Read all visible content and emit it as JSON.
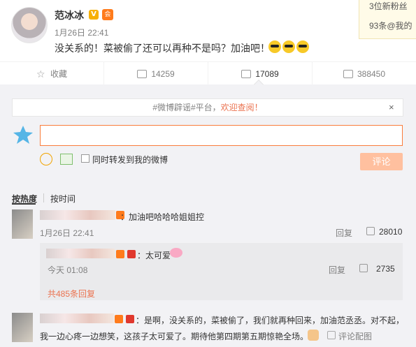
{
  "post": {
    "username": "范冰冰",
    "v_badge": "V",
    "vip_badge": "会",
    "time": "1月26日 22:41",
    "text": "没关系的！菜被偷了还可以再种不是吗？加油吧！"
  },
  "side_panel": {
    "line1": "3位新粉丝",
    "line2": "93条@我的"
  },
  "actions": {
    "favorite_label": "收藏",
    "repost_count": "14259",
    "comment_count": "17089",
    "like_count": "388450"
  },
  "notice": {
    "prefix": "#微博辟谣#平台，",
    "highlight": "欢迎查阅！",
    "close": "×"
  },
  "compose": {
    "placeholder": "",
    "repost_label": "同时转发到我的微博",
    "submit_label": "评论"
  },
  "sort_tabs": {
    "hot": "按热度",
    "time": "按时间"
  },
  "comments": [
    {
      "text": "：加油吧哈哈哈姐姐控",
      "time": "1月26日 22:41",
      "reply_label": "回复",
      "likes": "28010"
    },
    {
      "text": "：太可爱",
      "time": "今天 01:08",
      "reply_label": "回复",
      "likes": "2735",
      "more_replies": "共485条回复"
    },
    {
      "text_line1": "：是啊，没关系的，菜被偷了，我们就再种回来，加油范丞丞。对不起，",
      "text_line2": "我一边心疼一边想笑，这孩子太可爱了。期待他第四期第五期惊艳全场。",
      "report_label": "评论配图"
    }
  ],
  "colors": {
    "accent": "#eb7350",
    "compose_border": "#fa7d3c",
    "submit_disabled": "#ffc09f",
    "area_bg": "#f2f2f5"
  }
}
